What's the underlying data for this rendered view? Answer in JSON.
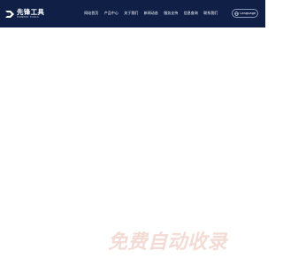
{
  "header": {
    "logo_cn": "先锋工具",
    "logo_en": "PIONEER TOOLS",
    "background_color": "#0f1f46"
  },
  "nav": {
    "items": [
      {
        "label": "网站首页"
      },
      {
        "label": "产品中心"
      },
      {
        "label": "关于我们"
      },
      {
        "label": "新闻动态"
      },
      {
        "label": "服务支持"
      },
      {
        "label": "信息查询"
      },
      {
        "label": "联系我们"
      }
    ]
  },
  "language": {
    "label": "Language",
    "icon": "globe-icon"
  },
  "watermark": {
    "text": "免费自动收录",
    "color": "#f3dcd5"
  }
}
